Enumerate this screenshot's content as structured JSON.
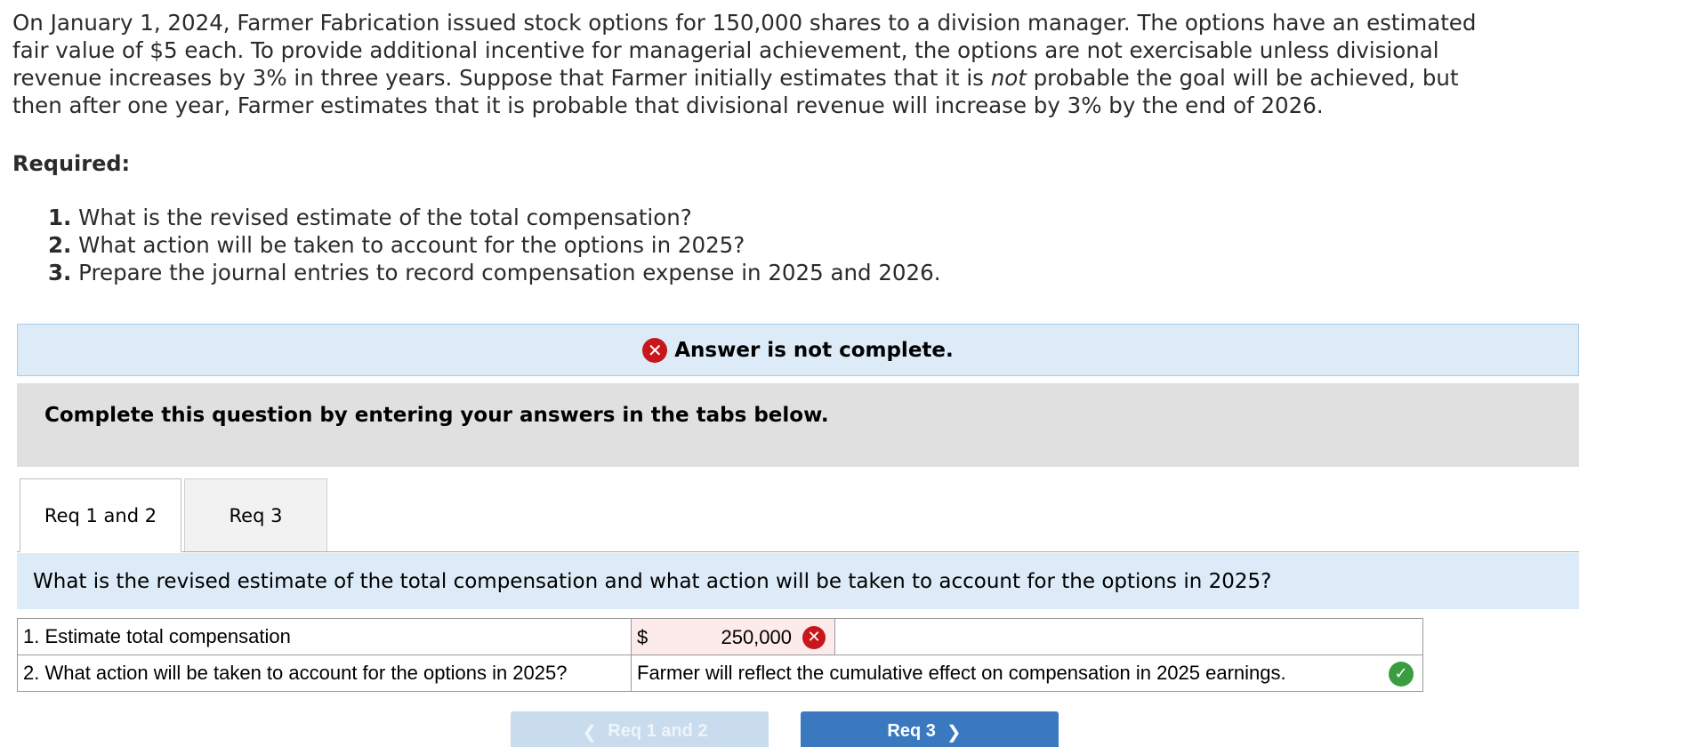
{
  "problem": {
    "intro_part1": "On January 1, 2024, Farmer Fabrication issued stock options for 150,000 shares to a division manager. The options have an estimated fair value of $5 each. To provide additional incentive for managerial achievement, the options are not exercisable unless divisional revenue increases by 3% in three years. Suppose that Farmer initially estimates that it is ",
    "intro_emphasis": "not",
    "intro_part2": " probable the goal will be achieved, but then after one year, Farmer estimates that it is probable that divisional revenue will increase by 3% by the end of 2026.",
    "required_heading": "Required:",
    "requirements": [
      {
        "number": "1.",
        "text": "What is the revised estimate of the total compensation?"
      },
      {
        "number": "2.",
        "text": "What action will be taken to account for the options in 2025?"
      },
      {
        "number": "3.",
        "text": "Prepare the journal entries to record compensation expense in 2025 and 2026."
      }
    ]
  },
  "status": {
    "icon": "x-circle-icon",
    "text": "Answer is not complete.",
    "color": "#c8161d"
  },
  "instructions": "Complete this question by entering your answers in the tabs below.",
  "tabs": [
    {
      "label": "Req 1 and 2",
      "active": true
    },
    {
      "label": "Req 3",
      "active": false
    }
  ],
  "question": "What is the revised estimate of the total compensation and what action will be taken to account for the options in 2025?",
  "answers": {
    "row1": {
      "label": "1. Estimate total compensation",
      "currency": "$",
      "value": "250,000",
      "status": "incorrect"
    },
    "row2": {
      "label": "2. What action will be taken to account for the options in 2025?",
      "value": "Farmer will reflect the cumulative effect on compensation in 2025 earnings.",
      "status": "correct"
    }
  },
  "nav": {
    "prev_label": "Req 1 and 2",
    "next_label": "Req 3",
    "prev_icon": "chevron-left-icon",
    "next_icon": "chevron-right-icon"
  },
  "colors": {
    "banner_bg": "#dcebf7",
    "instructions_bg": "#e0e0e0",
    "next_button": "#3a79c0",
    "correct": "#3a9d3f",
    "incorrect": "#c8161d"
  }
}
